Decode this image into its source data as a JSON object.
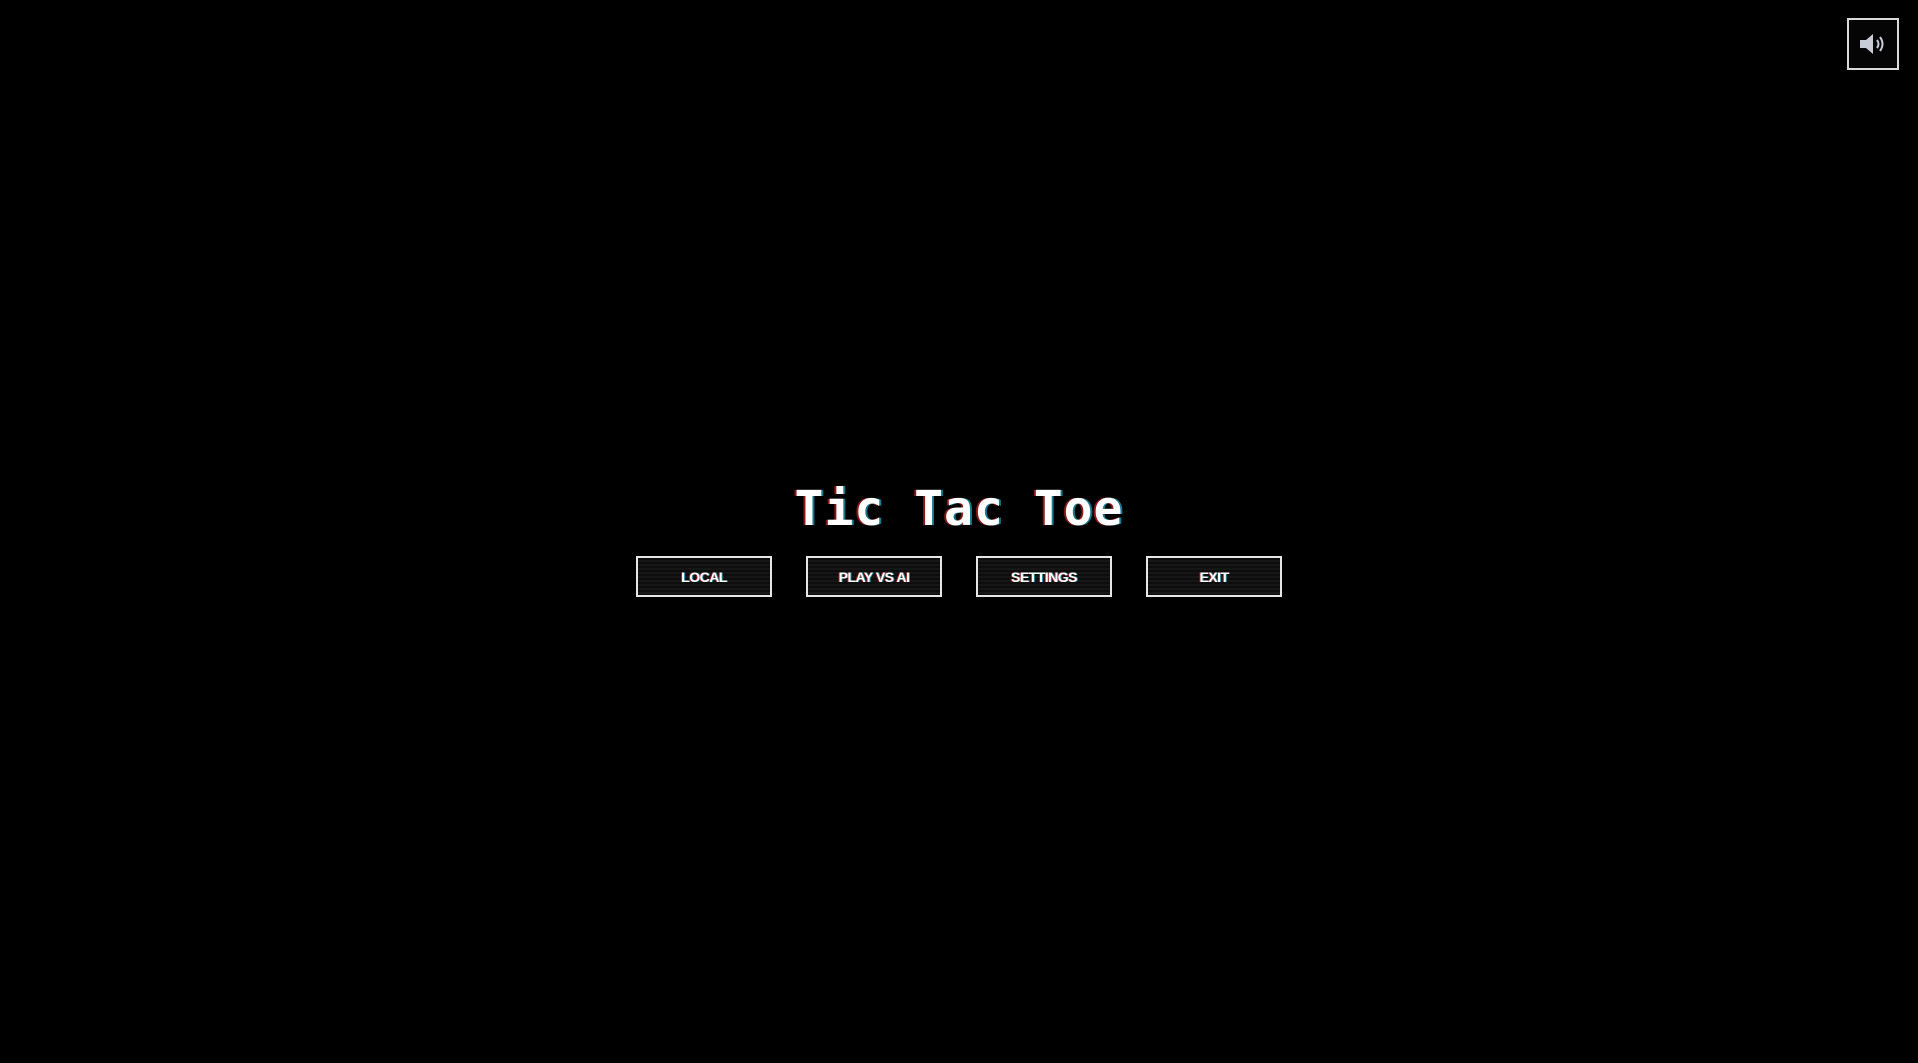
{
  "game": {
    "title": "Tic Tac Toe"
  },
  "menu": {
    "buttons": [
      {
        "label": "LOCAL"
      },
      {
        "label": "PLAY VS AI"
      },
      {
        "label": "SETTINGS"
      },
      {
        "label": "EXIT"
      }
    ]
  },
  "sound": {
    "icon": "speaker-volume-icon",
    "state": "on"
  },
  "colors": {
    "background": "#000000",
    "text": "#ffffff",
    "border": "#e6e6e6",
    "glitch_red": "#ff2828",
    "glitch_cyan": "#28dcff"
  }
}
